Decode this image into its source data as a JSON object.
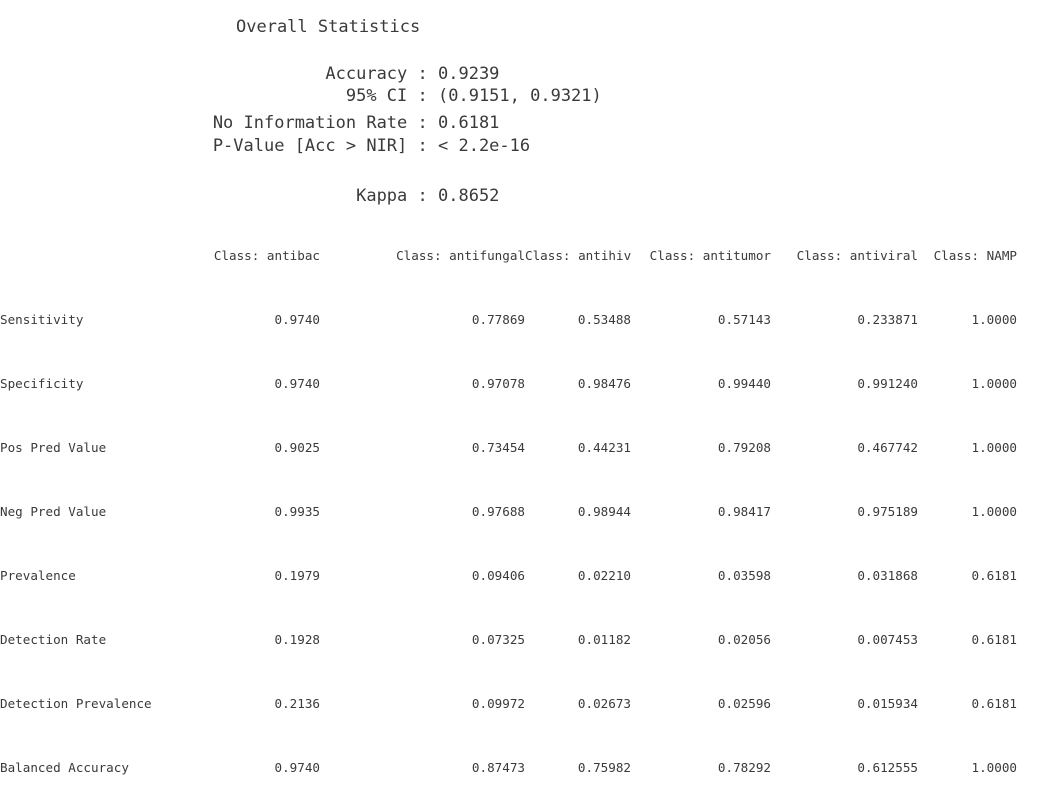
{
  "title": "Overall Statistics",
  "stats": [
    {
      "label": "Accuracy",
      "value": "0.9239"
    },
    {
      "label": "95% CI",
      "value": "(0.9151, 0.9321)"
    },
    {
      "label": "No Information Rate",
      "value": "0.6181"
    },
    {
      "label": "P-Value [Acc > NIR]",
      "value": "< 2.2e-16"
    },
    {
      "label": "Kappa",
      "value": "0.8652"
    }
  ],
  "separator": " : ",
  "table": {
    "columns": [
      "Class: antibac",
      "Class: antifungal",
      "Class: antihiv",
      "Class: antitumor",
      "Class: antiviral",
      "Class: NAMP"
    ],
    "rows": [
      {
        "label": "Sensitivity",
        "values": [
          "0.9740",
          "0.77869",
          "0.53488",
          "0.57143",
          "0.233871",
          "1.0000"
        ]
      },
      {
        "label": "Specificity",
        "values": [
          "0.9740",
          "0.97078",
          "0.98476",
          "0.99440",
          "0.991240",
          "1.0000"
        ]
      },
      {
        "label": "Pos Pred Value",
        "values": [
          "0.9025",
          "0.73454",
          "0.44231",
          "0.79208",
          "0.467742",
          "1.0000"
        ]
      },
      {
        "label": "Neg Pred Value",
        "values": [
          "0.9935",
          "0.97688",
          "0.98944",
          "0.98417",
          "0.975189",
          "1.0000"
        ]
      },
      {
        "label": "Prevalence",
        "values": [
          "0.1979",
          "0.09406",
          "0.02210",
          "0.03598",
          "0.031868",
          "0.6181"
        ]
      },
      {
        "label": "Detection Rate",
        "values": [
          "0.1928",
          "0.07325",
          "0.01182",
          "0.02056",
          "0.007453",
          "0.6181"
        ]
      },
      {
        "label": "Detection Prevalence",
        "values": [
          "0.2136",
          "0.09972",
          "0.02673",
          "0.02596",
          "0.015934",
          "0.6181"
        ]
      },
      {
        "label": "Balanced Accuracy",
        "values": [
          "0.9740",
          "0.87473",
          "0.75982",
          "0.78292",
          "0.612555",
          "1.0000"
        ]
      }
    ]
  }
}
